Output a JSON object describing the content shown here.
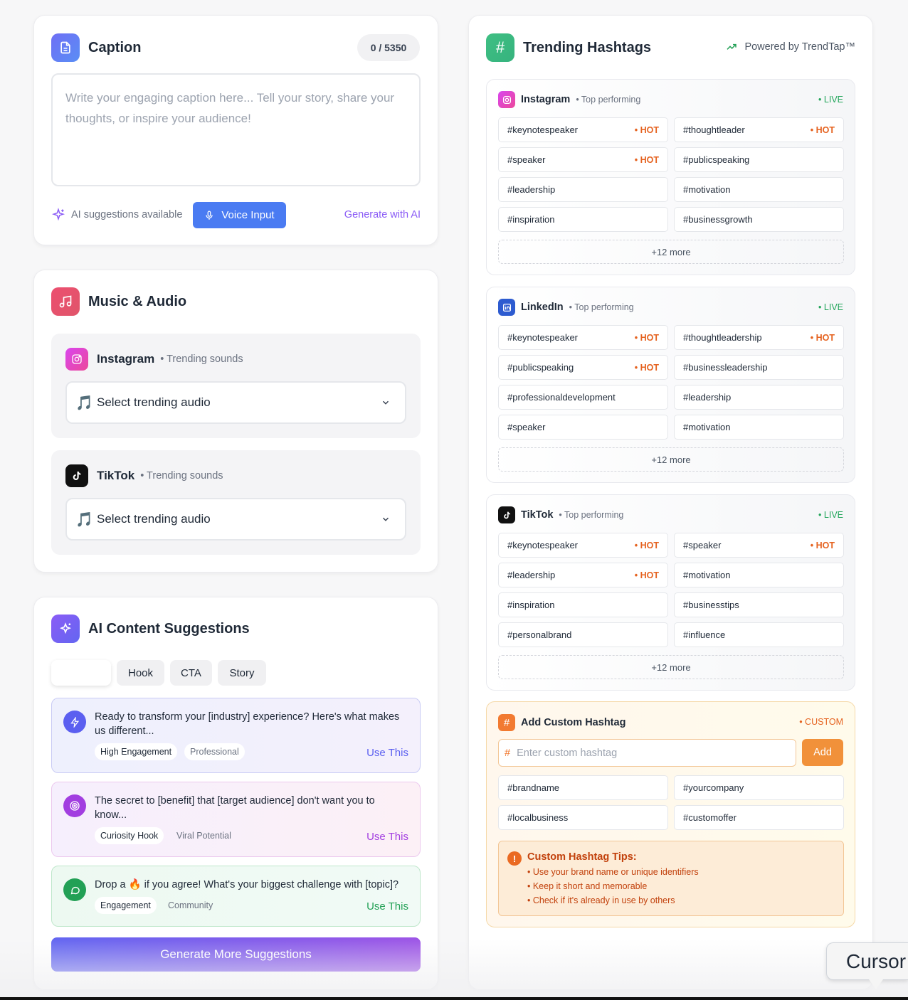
{
  "caption": {
    "title": "Caption",
    "counter": "0 / 5350",
    "placeholder": "Write your engaging caption here... Tell your story, share your thoughts, or inspire your audience!",
    "ai_note": "AI suggestions available",
    "voice_label": "Voice Input",
    "generate_label": "Generate with AI"
  },
  "music": {
    "title": "Music & Audio",
    "platforms": [
      {
        "name": "Instagram",
        "sub": "• Trending sounds",
        "select": "Select trending audio"
      },
      {
        "name": "TikTok",
        "sub": "• Trending sounds",
        "select": "Select trending audio"
      }
    ]
  },
  "ai": {
    "title": "AI Content Suggestions",
    "tabs": [
      "",
      "Hook",
      "CTA",
      "Story"
    ],
    "suggestions": [
      {
        "text": "Ready to transform your [industry] experience? Here's what makes us different...",
        "chips": [
          "High Engagement",
          "Professional"
        ],
        "use": "Use This",
        "accent": "#5b5ff0"
      },
      {
        "text": "The secret to [benefit] that [target audience] don't want you to know...",
        "chips": [
          "Curiosity Hook",
          "Viral Potential"
        ],
        "use": "Use This",
        "accent": "#a23ee0"
      },
      {
        "text": "Drop a 🔥 if you agree! What's your biggest challenge with [topic]?",
        "chips": [
          "Engagement",
          "Community"
        ],
        "use": "Use This",
        "accent": "#22a055"
      }
    ],
    "more_label": "Generate More Suggestions"
  },
  "trending": {
    "title": "Trending Hashtags",
    "powered": "Powered by TrendTap™",
    "sections": [
      {
        "name": "Instagram",
        "sub": "• Top performing",
        "live": "• LIVE",
        "more": "+12 more",
        "tags": [
          [
            "#keynotespeaker",
            "• HOT"
          ],
          [
            "#thoughtleader",
            "• HOT"
          ],
          [
            "#speaker",
            "• HOT"
          ],
          [
            "#publicspeaking",
            ""
          ],
          [
            "#leadership",
            ""
          ],
          [
            "#motivation",
            ""
          ],
          [
            "#inspiration",
            ""
          ],
          [
            "#businessgrowth",
            ""
          ]
        ]
      },
      {
        "name": "LinkedIn",
        "sub": "• Top performing",
        "live": "• LIVE",
        "more": "+12 more",
        "tags": [
          [
            "#keynotespeaker",
            "• HOT"
          ],
          [
            "#thoughtleadership",
            "• HOT"
          ],
          [
            "#publicspeaking",
            "• HOT"
          ],
          [
            "#businessleadership",
            ""
          ],
          [
            "#professionaldevelopment",
            ""
          ],
          [
            "#leadership",
            ""
          ],
          [
            "#speaker",
            ""
          ],
          [
            "#motivation",
            ""
          ]
        ]
      },
      {
        "name": "TikTok",
        "sub": "• Top performing",
        "live": "• LIVE",
        "more": "+12 more",
        "tags": [
          [
            "#keynotespeaker",
            "• HOT"
          ],
          [
            "#speaker",
            "• HOT"
          ],
          [
            "#leadership",
            "• HOT"
          ],
          [
            "#motivation",
            ""
          ],
          [
            "#inspiration",
            ""
          ],
          [
            "#businesstips",
            ""
          ],
          [
            "#personalbrand",
            ""
          ],
          [
            "#influence",
            ""
          ]
        ]
      }
    ],
    "custom": {
      "title": "Add Custom Hashtag",
      "badge": "• CUSTOM",
      "placeholder": "Enter custom hashtag",
      "add": "Add",
      "tags": [
        "#brandname",
        "#yourcompany",
        "#localbusiness",
        "#customoffer"
      ],
      "tips_title": "Custom Hashtag Tips:",
      "tips": [
        "• Use your brand name or unique identifiers",
        "• Keep it short and memorable",
        "• Check if it's already in use by others"
      ]
    }
  },
  "tooltip": "Cursor"
}
